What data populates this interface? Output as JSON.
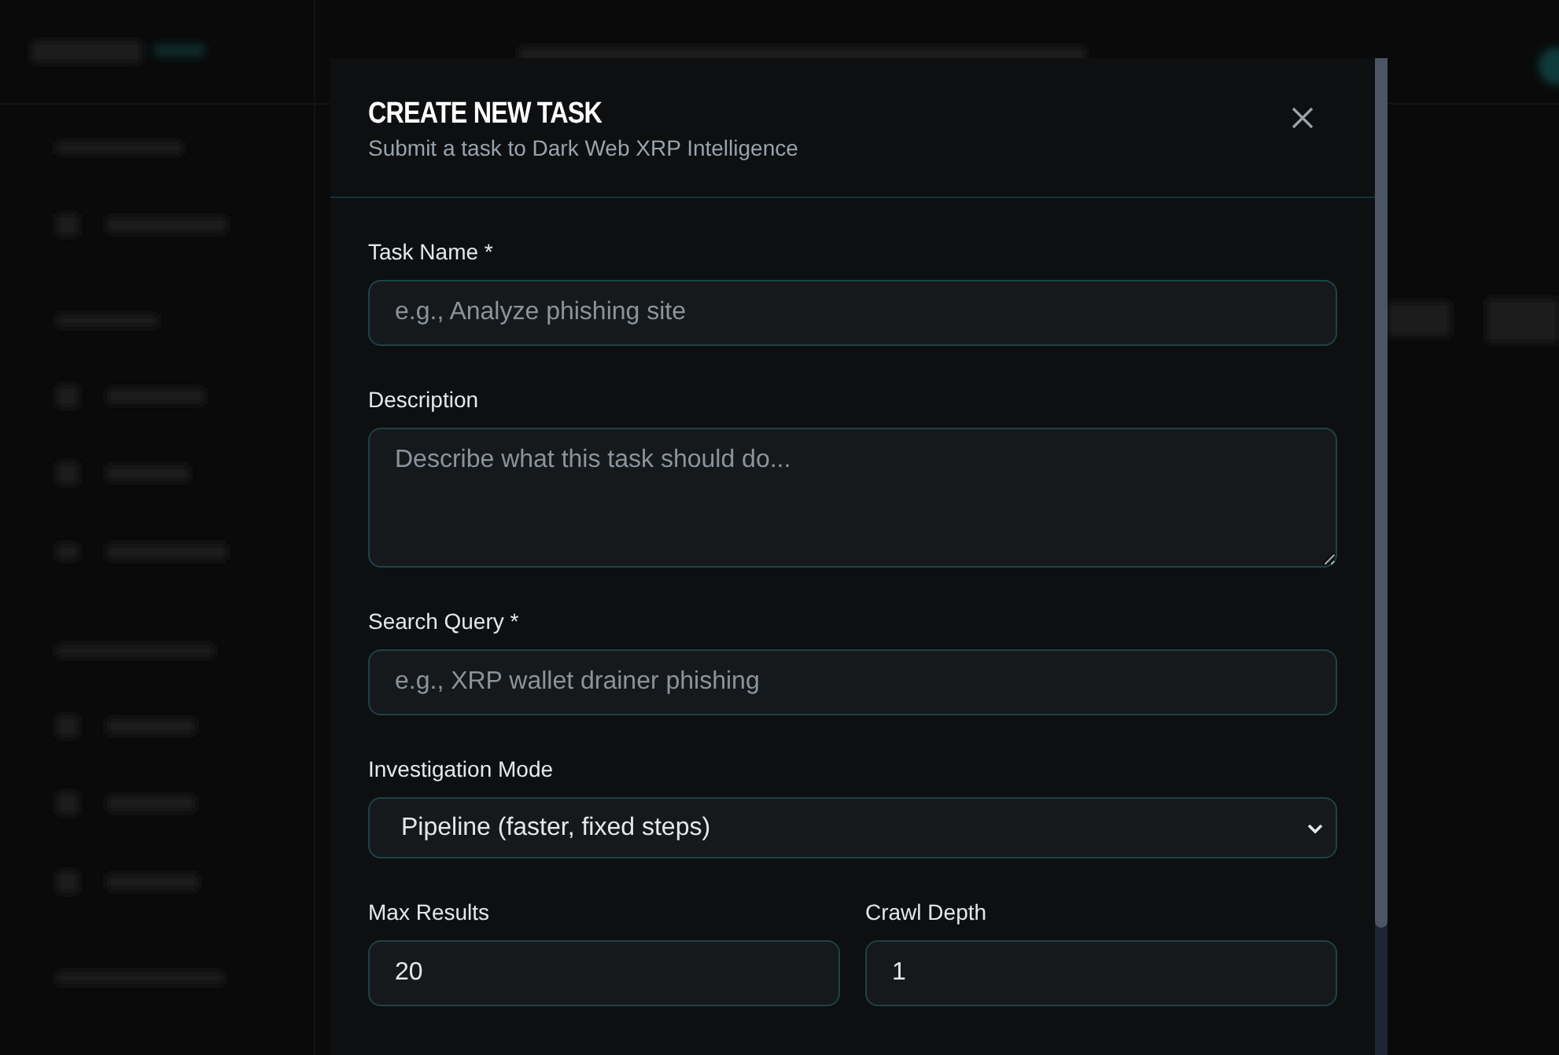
{
  "dialog": {
    "title": "CREATE NEW TASK",
    "subtitle": "Submit a task to Dark Web XRP Intelligence",
    "fields": [
      {
        "kind": "text",
        "label": "Task Name *",
        "placeholder": "e.g., Analyze phishing site"
      },
      {
        "kind": "textarea",
        "label": "Description",
        "placeholder": "Describe what this task should do..."
      },
      {
        "kind": "text",
        "label": "Search Query *",
        "placeholder": "e.g., XRP wallet drainer phishing"
      },
      {
        "kind": "select",
        "label": "Investigation Mode",
        "value": "Pipeline (faster, fixed steps)"
      }
    ],
    "pair_fields": [
      {
        "label": "Max Results",
        "value": "20"
      },
      {
        "label": "Crawl Depth",
        "value": "1"
      }
    ]
  }
}
